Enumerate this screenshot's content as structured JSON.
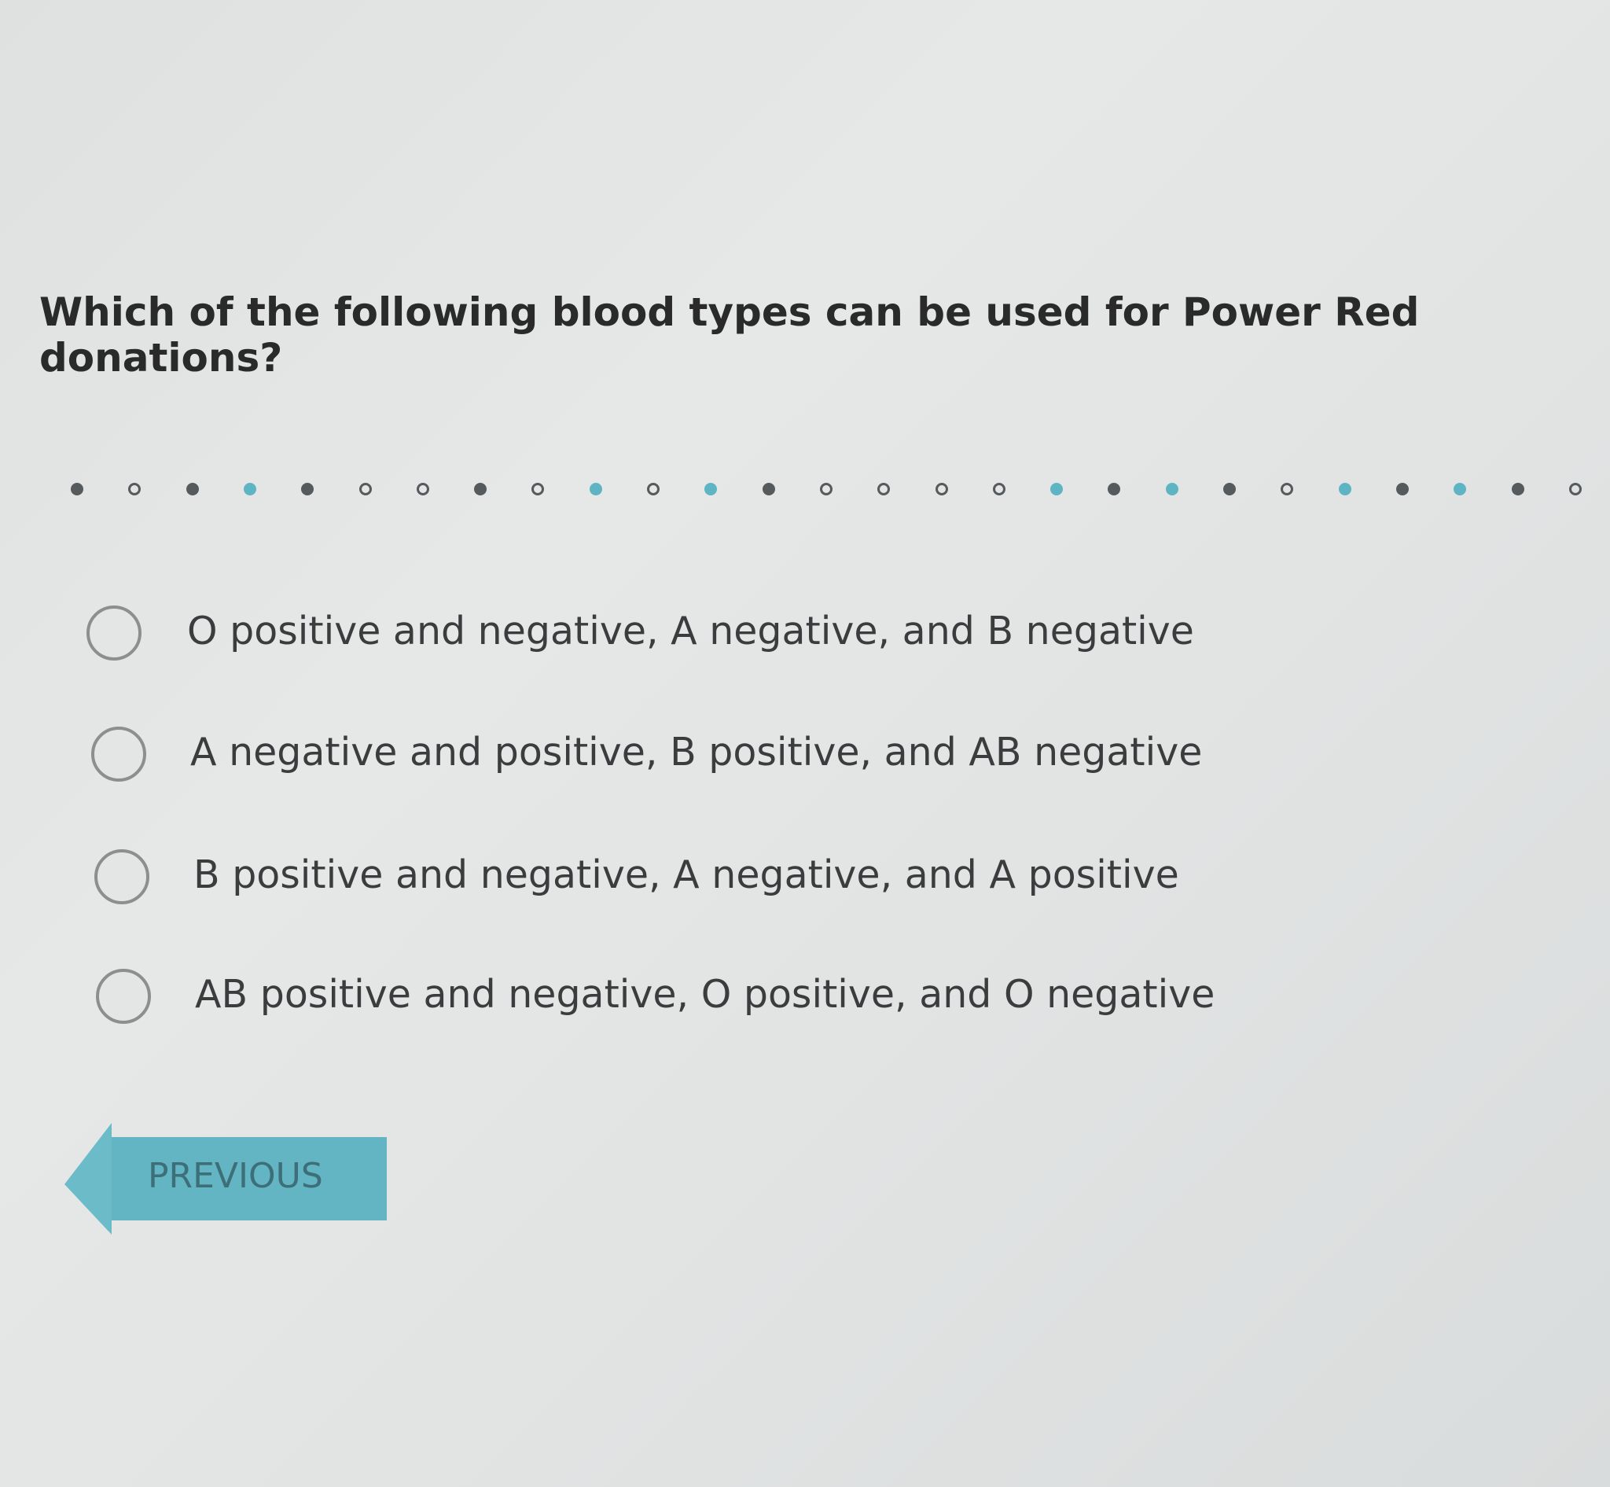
{
  "question": {
    "text": "Which of the following blood types can be used for Power Red donations?"
  },
  "progress": {
    "states": [
      "done",
      "open",
      "done",
      "accent",
      "done",
      "open",
      "open",
      "done",
      "open",
      "accent",
      "open",
      "accent",
      "done",
      "open",
      "open",
      "open",
      "open",
      "accent",
      "done",
      "accent",
      "done",
      "open",
      "accent",
      "done",
      "accent",
      "done",
      "open"
    ]
  },
  "options": [
    {
      "label": "O positive and negative, A negative, and B negative"
    },
    {
      "label": "A negative and positive, B positive, and AB negative"
    },
    {
      "label": "B positive and negative, A negative, and A positive"
    },
    {
      "label": "AB positive and negative, O positive, and O negative"
    }
  ],
  "nav": {
    "previous_label": "PREVIOUS"
  },
  "colors": {
    "accent": "#5fb4c4",
    "dot": "#555a5c",
    "radio_border": "#8c8f90",
    "text": "#3a3c3d"
  }
}
